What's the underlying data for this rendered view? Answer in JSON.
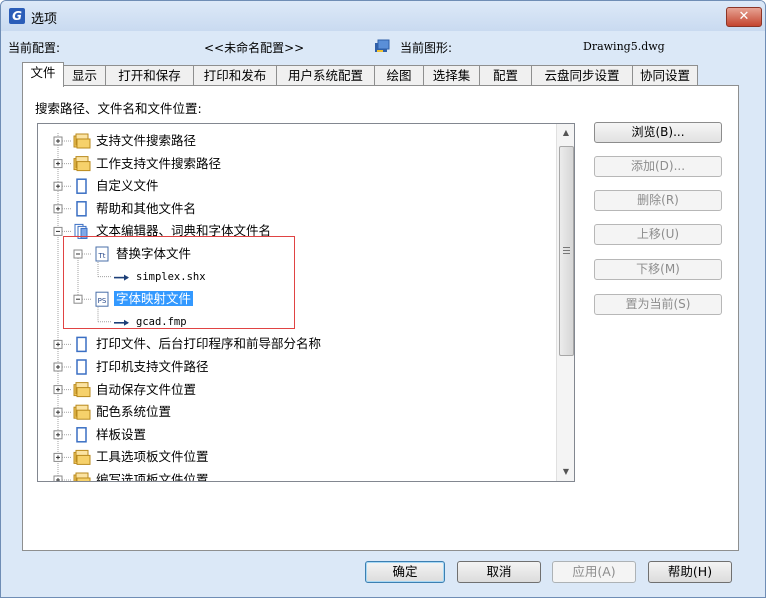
{
  "window": {
    "title": "选项",
    "close_label": "✕"
  },
  "info": {
    "config_label": "当前配置:",
    "config_value": "<<未命名配置>>",
    "drawing_label": "当前图形:",
    "drawing_value": "Drawing5.dwg"
  },
  "tabs": [
    "文件",
    "显示",
    "打开和保存",
    "打印和发布",
    "用户系统配置",
    "绘图",
    "选择集",
    "配置",
    "云盘同步设置",
    "协同设置"
  ],
  "active_tab": "文件",
  "panel": {
    "label": "搜索路径、文件名和文件位置:"
  },
  "tree": [
    {
      "label": "支持文件搜索路径",
      "expander": "+",
      "icon": "folder-stack-icon"
    },
    {
      "label": "工作支持文件搜索路径",
      "expander": "+",
      "icon": "folder-stack-icon"
    },
    {
      "label": "自定义文件",
      "expander": "+",
      "icon": "file-blue-icon"
    },
    {
      "label": "帮助和其他文件名",
      "expander": "+",
      "icon": "file-blue-icon"
    },
    {
      "label": "文本编辑器、词典和字体文件名",
      "expander": "-",
      "icon": "file-stack-icon"
    },
    {
      "label": "替换字体文件",
      "expander": "-",
      "icon": "ttf-font-icon"
    },
    {
      "label": "simplex.shx",
      "expander": "",
      "icon": "arrow-path-icon"
    },
    {
      "label": "字体映射文件",
      "expander": "-",
      "icon": "ps-font-icon",
      "selected": true
    },
    {
      "label": "gcad.fmp",
      "expander": "",
      "icon": "arrow-path-icon"
    },
    {
      "label": "打印文件、后台打印程序和前导部分名称",
      "expander": "+",
      "icon": "file-blue-icon"
    },
    {
      "label": "打印机支持文件路径",
      "expander": "+",
      "icon": "file-blue-icon"
    },
    {
      "label": "自动保存文件位置",
      "expander": "+",
      "icon": "folder-stack-icon"
    },
    {
      "label": "配色系统位置",
      "expander": "+",
      "icon": "folder-stack-icon"
    },
    {
      "label": "样板设置",
      "expander": "+",
      "icon": "file-blue-icon"
    },
    {
      "label": "工具选项板文件位置",
      "expander": "+",
      "icon": "folder-stack-icon"
    },
    {
      "label": "编写选项板文件位置",
      "expander": "+",
      "icon": "folder-stack-icon"
    }
  ],
  "side_buttons": [
    {
      "label": "浏览(B)...",
      "enabled": true
    },
    {
      "label": "添加(D)...",
      "enabled": false
    },
    {
      "label": "删除(R)",
      "enabled": false
    },
    {
      "label": "上移(U)",
      "enabled": false
    },
    {
      "label": "下移(M)",
      "enabled": false
    },
    {
      "label": "置为当前(S)",
      "enabled": false
    }
  ],
  "bottom_buttons": {
    "ok": "确定",
    "cancel": "取消",
    "apply": "应用(A)",
    "help": "帮助(H)"
  },
  "colors": {
    "selection": "#3399ff",
    "annotation_box": "#e04343",
    "folder": "#f4c95d",
    "file": "#3a6fc4"
  }
}
